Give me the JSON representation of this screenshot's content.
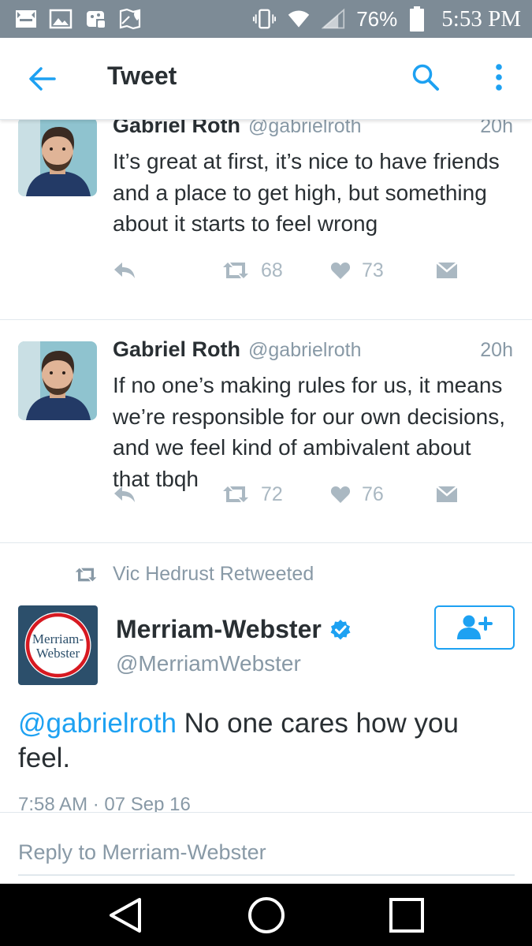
{
  "status_bar": {
    "battery": "76%",
    "time": "5:53 PM",
    "icons": [
      "notification-icon",
      "gallery-icon",
      "game-controller-icon",
      "maps-icon",
      "vibrate-icon",
      "wifi-icon",
      "signal-icon",
      "battery-icon"
    ]
  },
  "header": {
    "title": "Tweet",
    "back_icon": "back-arrow-icon",
    "search_icon": "search-icon",
    "more_icon": "more-vertical-icon"
  },
  "tweets": [
    {
      "name": "Gabriel Roth",
      "handle": "@gabrielroth",
      "time": "20h",
      "text": "It’s great at first, it’s nice to have friends and a place to get high, but something about it starts to feel wrong",
      "retweets": "68",
      "likes": "73"
    },
    {
      "name": "Gabriel Roth",
      "handle": "@gabrielroth",
      "time": "20h",
      "text": "If no one’s making rules for us, it means we’re responsible for our own decisions, and we feel kind of ambivalent about that tbqh",
      "retweets": "72",
      "likes": "76"
    }
  ],
  "retweeted": {
    "context": "Vic Hedrust Retweeted",
    "name": "Merriam-Webster",
    "handle": "@MerriamWebster",
    "verified": true,
    "mention": "@gabrielroth",
    "text": " No one cares how you feel.",
    "timestamp": "7:58 AM · 07 Sep 16",
    "logo_text_line1": "Merriam-",
    "logo_text_line2": "Webster"
  },
  "reply": {
    "placeholder": "Reply to Merriam-Webster"
  },
  "colors": {
    "accent": "#1da1f2",
    "status_bar": "#7d8b96",
    "action_gray": "#aab8c2",
    "meta_gray": "#8899a6",
    "mw_navy": "#2c4f6b",
    "mw_red": "#d71921"
  }
}
